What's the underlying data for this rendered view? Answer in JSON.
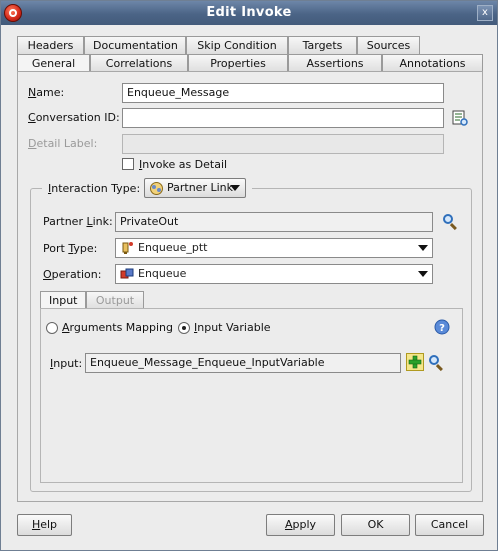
{
  "window": {
    "title": "Edit Invoke",
    "close_glyph": "x"
  },
  "tabs_row1": [
    "Headers",
    "Documentation",
    "Skip Condition",
    "Targets",
    "Sources"
  ],
  "tabs_row2": [
    "General",
    "Correlations",
    "Properties",
    "Assertions",
    "Annotations"
  ],
  "selected_tab": "General",
  "general": {
    "name_label_u": "N",
    "name_label_rest": "ame:",
    "name_value": "Enqueue_Message",
    "conversation_label_u": "C",
    "conversation_label_rest": "onversation ID:",
    "conversation_value": "",
    "detail_label_u": "D",
    "detail_label_rest": "etail Label:",
    "detail_value": "",
    "invoke_as_detail_u": "I",
    "invoke_as_detail_rest": "nvoke as Detail",
    "invoke_as_detail_checked": false
  },
  "interaction": {
    "type_label_u": "I",
    "type_label_rest": "nteraction Type:",
    "type_value": "Partner Link",
    "partner_link_label_pre": "Partner ",
    "partner_link_label_u": "L",
    "partner_link_label_rest": "ink:",
    "partner_link_value": "PrivateOut",
    "port_type_label_pre": "Port ",
    "port_type_label_u": "T",
    "port_type_label_rest": "ype:",
    "port_type_value": "Enqueue_ptt",
    "operation_label_u": "O",
    "operation_label_rest": "peration:",
    "operation_value": "Enqueue"
  },
  "io_tabs": {
    "input": "Input",
    "output": "Output",
    "selected": "Input"
  },
  "input_section": {
    "arguments_mapping_u": "A",
    "arguments_mapping_rest": "rguments Mapping",
    "input_variable_pre": "I",
    "input_variable_rest": "nput Variable",
    "selected_option": "Input Variable",
    "input_label_pre": "I",
    "input_label_rest": "nput:",
    "input_value": "Enqueue_Message_Enqueue_InputVariable"
  },
  "buttons": {
    "help_u": "H",
    "help_rest": "elp",
    "apply_u": "A",
    "apply_rest": "pply",
    "ok": "OK",
    "cancel": "Cancel"
  },
  "colors": {
    "titlebar": "#4b6486",
    "window_bg": "#ececec",
    "accent_icon": "#2f6fbb",
    "add_green": "#2aa12a",
    "help_blue": "#3b7ad0"
  },
  "icons": [
    "app-logo-icon",
    "close-icon",
    "variables-picker-icon",
    "partner-link-icon",
    "port-type-icon",
    "operation-icon",
    "search-icon",
    "add-icon",
    "help-icon"
  ]
}
